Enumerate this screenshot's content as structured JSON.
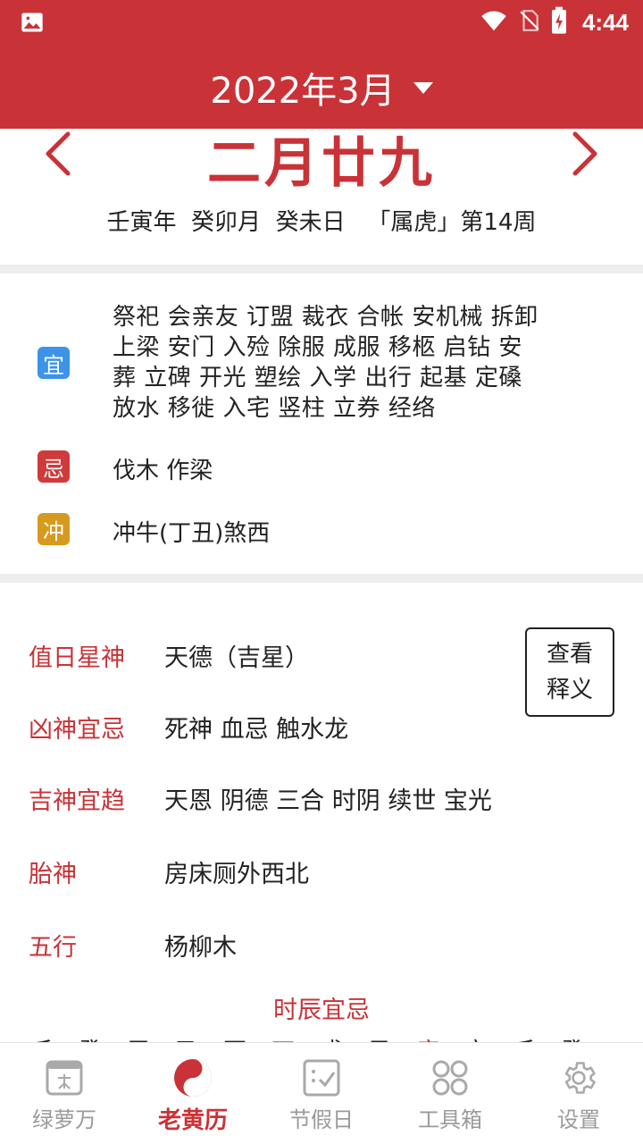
{
  "status": {
    "time": "4:44"
  },
  "header": {
    "month": "2022年3月"
  },
  "date": {
    "lunar": "二月廿九",
    "ganzhi": "壬寅年  癸卯月  癸未日   「属虎」第14周"
  },
  "yiji": {
    "yi_tag": "宜",
    "yi_text": "祭祀 会亲友 订盟 裁衣 合帐 安机械 拆卸 上梁 安门 入殓 除服 成服 移柩 启钻 安葬 立碑 开光 塑绘 入学 出行 起基 定磉 放水 移徙 入宅 竖柱 立券 经络",
    "ji_tag": "忌",
    "ji_text": "伐木 作梁",
    "chong_tag": "冲",
    "chong_text": "冲牛(丁丑)煞西"
  },
  "gods": {
    "rows": [
      {
        "label": "值日星神",
        "value": "天德（吉星）"
      },
      {
        "label": "凶神宜忌",
        "value": "死神 血忌 触水龙"
      },
      {
        "label": "吉神宜趋",
        "value": "天恩 阴德 三合 时阴 续世 宝光"
      },
      {
        "label": "胎神",
        "value": "房床厕外西北"
      },
      {
        "label": "五行",
        "value": "杨柳木"
      }
    ],
    "explain_button": "查看释义",
    "shichen_title": "时辰宜忌",
    "shichen": [
      "壬",
      "癸",
      "甲",
      "乙",
      "丙",
      "丁",
      "戊",
      "己",
      "庚",
      "辛",
      "壬",
      "癸"
    ]
  },
  "nav": {
    "items": [
      {
        "label": "绿萝万",
        "icon": "calendar-icon"
      },
      {
        "label": "老黄历",
        "icon": "yinyang-icon"
      },
      {
        "label": "节假日",
        "icon": "holiday-icon"
      },
      {
        "label": "工具箱",
        "icon": "toolbox-icon"
      },
      {
        "label": "设置",
        "icon": "gear-icon"
      }
    ],
    "active_index": 1
  },
  "colors": {
    "primary": "#c93237",
    "yi": "#3d93e8",
    "ji": "#d03a3a",
    "chong": "#d69a1f"
  }
}
